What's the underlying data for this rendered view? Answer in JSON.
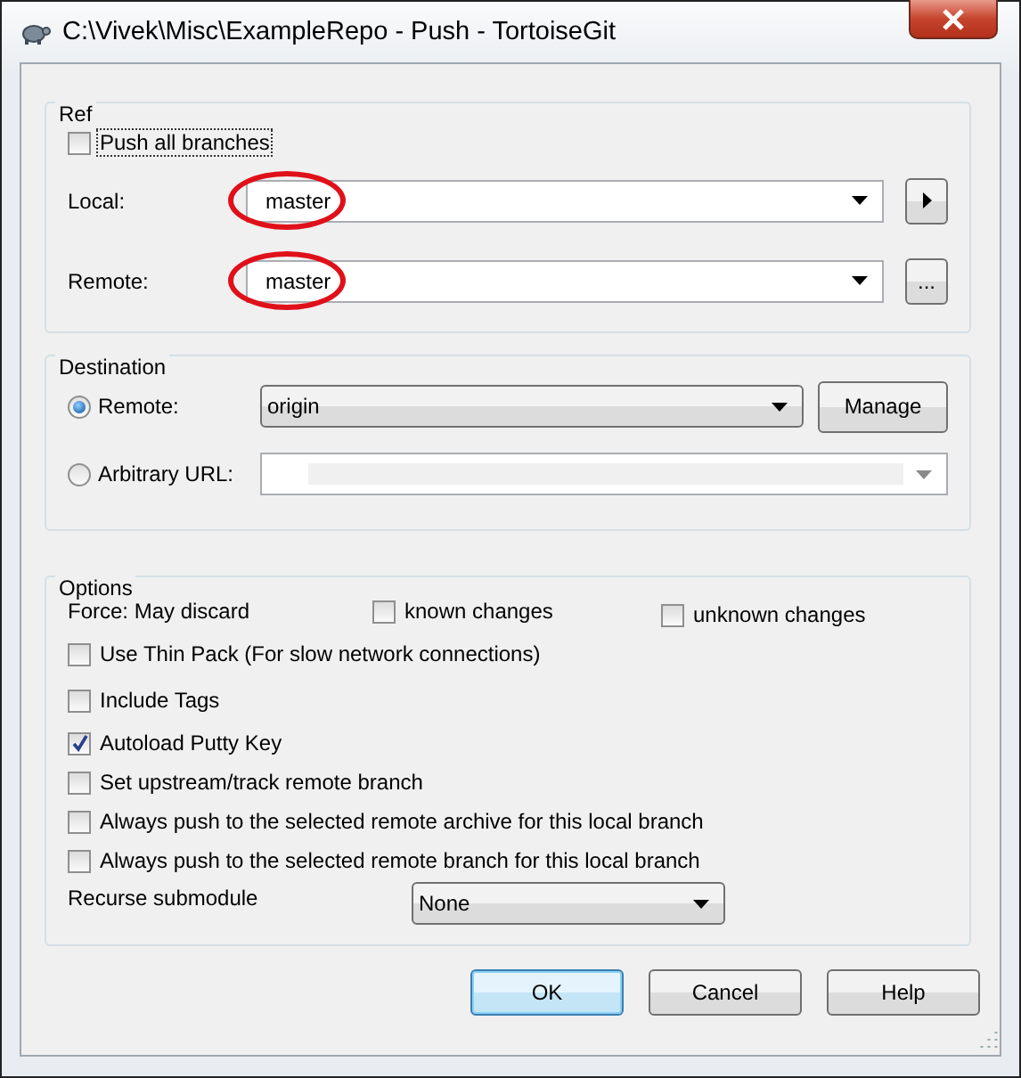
{
  "window": {
    "title": "C:\\Vivek\\Misc\\ExampleRepo - Push - TortoiseGit"
  },
  "ref": {
    "title": "Ref",
    "push_all": {
      "label": "Push all branches",
      "checked": false,
      "focused": true
    },
    "rows": [
      {
        "label": "Local:",
        "value": "master",
        "circled": true,
        "button": {
          "kind": "arrow"
        }
      },
      {
        "label": "Remote:",
        "value": "master",
        "circled": true,
        "button": {
          "kind": "text",
          "label": "..."
        }
      }
    ]
  },
  "destination": {
    "title": "Destination",
    "options": [
      {
        "kind": "combo",
        "label": "Remote:",
        "selected": true,
        "value": "origin"
      },
      {
        "kind": "edit",
        "label": "Arbitrary URL:",
        "selected": false,
        "disabled": true
      }
    ],
    "manage_button": "Manage"
  },
  "options": {
    "title": "Options",
    "force_label": "Force: May discard",
    "force": [
      {
        "label": "known changes",
        "checked": false
      },
      {
        "label": "unknown changes",
        "checked": false
      }
    ],
    "checks": [
      {
        "label": "Use Thin Pack (For slow network connections)",
        "checked": false
      },
      {
        "label": "Include Tags",
        "checked": false
      },
      {
        "label": "Autoload Putty Key",
        "checked": true
      },
      {
        "label": "Set upstream/track remote branch",
        "checked": false
      },
      {
        "label": "Always push to the selected remote archive for this local branch",
        "checked": false
      },
      {
        "label": "Always push to the selected remote branch for this local branch",
        "checked": false
      }
    ],
    "recurse": {
      "label": "Recurse submodule",
      "value": "None"
    }
  },
  "buttons": [
    {
      "label": "OK",
      "default": true
    },
    {
      "label": "Cancel",
      "default": false
    },
    {
      "label": "Help",
      "default": false
    }
  ]
}
